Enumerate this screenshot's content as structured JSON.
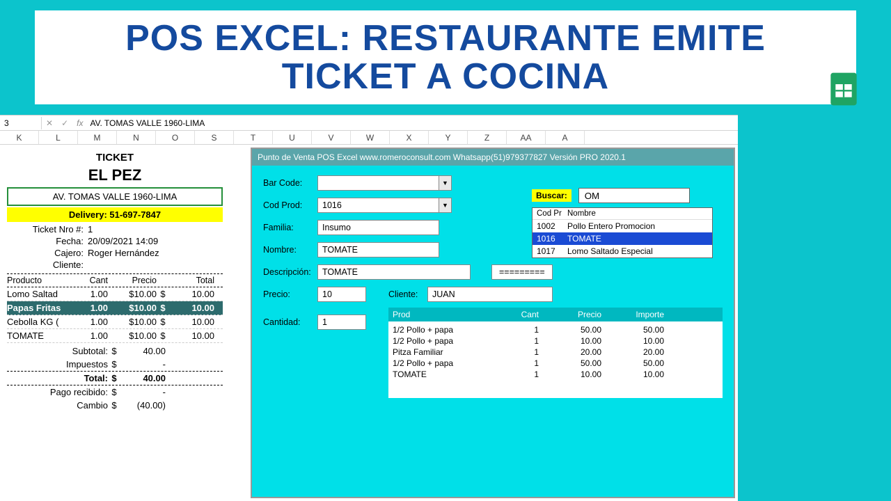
{
  "banner_title": "POS EXCEL: RESTAURANTE EMITE TICKET A COCINA",
  "formula_bar": {
    "cell": "3",
    "value": "AV. TOMAS VALLE 1960-LIMA"
  },
  "columns": [
    "K",
    "L",
    "M",
    "N",
    "O",
    "S",
    "T",
    "U",
    "V",
    "W",
    "X",
    "Y",
    "Z",
    "AA",
    "A"
  ],
  "ticket": {
    "title": "TICKET",
    "brand": "EL PEZ",
    "address": "AV. TOMAS VALLE 1960-LIMA",
    "delivery": "Delivery: 51-697-7847",
    "meta": {
      "num_lbl": "Ticket Nro #:",
      "num": "1",
      "date_lbl": "Fecha:",
      "date": "20/09/2021 14:09",
      "cashier_lbl": "Cajero:",
      "cashier": "Roger Hernández",
      "client_lbl": "Cliente:",
      "client": ""
    },
    "headers": {
      "prod": "Producto",
      "qty": "Cant",
      "price": "Precio",
      "tot": "Total"
    },
    "lines": [
      {
        "p": "Lomo Saltad",
        "q": "1.00",
        "pr": "$10.00",
        "s": "$",
        "t": "10.00",
        "sel": false
      },
      {
        "p": "Papas Fritas",
        "q": "1.00",
        "pr": "$10.00",
        "s": "$",
        "t": "10.00",
        "sel": true
      },
      {
        "p": "Cebolla KG (",
        "q": "1.00",
        "pr": "$10.00",
        "s": "$",
        "t": "10.00",
        "sel": false
      },
      {
        "p": "TOMATE",
        "q": "1.00",
        "pr": "$10.00",
        "s": "$",
        "t": "10.00",
        "sel": false
      }
    ],
    "subs": {
      "subtotal_lbl": "Subtotal:",
      "subtotal": "40.00",
      "subtotal_s": "$",
      "tax_lbl": "Impuestos",
      "tax": "-",
      "tax_s": "$",
      "total_lbl": "Total:",
      "total": "40.00",
      "total_s": "$",
      "paid_lbl": "Pago recibido:",
      "paid": "-",
      "paid_s": "$",
      "change_lbl": "Cambio",
      "change": "(40.00)",
      "change_s": "$"
    }
  },
  "pos": {
    "header": "Punto de Venta POS Excel  www.romeroconsult.com Whatsapp(51)979377827 Versión PRO 2020.1",
    "labels": {
      "barcode": "Bar Code:",
      "codprod": "Cod Prod:",
      "familia": "Familia:",
      "nombre": "Nombre:",
      "desc": "Descripción:",
      "precio": "Precio:",
      "cliente": "Cliente:",
      "cantidad": "Cantidad:",
      "buscar": "Buscar:"
    },
    "values": {
      "barcode": "",
      "codprod": "1016",
      "familia": "Insumo",
      "nombre": "TOMATE",
      "desc": "TOMATE",
      "eq": "=========",
      "precio": "10",
      "cliente": "JUAN",
      "cantidad": "1",
      "buscar": "OM"
    },
    "prodlist": {
      "headers": {
        "cod": "Cod Pr",
        "nom": "Nombre"
      },
      "rows": [
        {
          "c": "1002",
          "n": "Pollo Entero Promocion",
          "sel": false
        },
        {
          "c": "1016",
          "n": "TOMATE",
          "sel": true
        },
        {
          "c": "1017",
          "n": "Lomo Saltado Especial",
          "sel": false
        }
      ]
    },
    "cart": {
      "headers": {
        "p": "Prod",
        "q": "Cant",
        "pr": "Precio",
        "im": "Importe"
      },
      "rows": [
        {
          "p": "1/2 Pollo + papa",
          "q": "1",
          "pr": "50.00",
          "im": "50.00"
        },
        {
          "p": "1/2 Pollo + papa",
          "q": "1",
          "pr": "10.00",
          "im": "10.00"
        },
        {
          "p": "Pitza Familiar",
          "q": "1",
          "pr": "20.00",
          "im": "20.00"
        },
        {
          "p": "1/2 Pollo + papa",
          "q": "1",
          "pr": "50.00",
          "im": "50.00"
        },
        {
          "p": "TOMATE",
          "q": "1",
          "pr": "10.00",
          "im": "10.00"
        }
      ]
    }
  }
}
